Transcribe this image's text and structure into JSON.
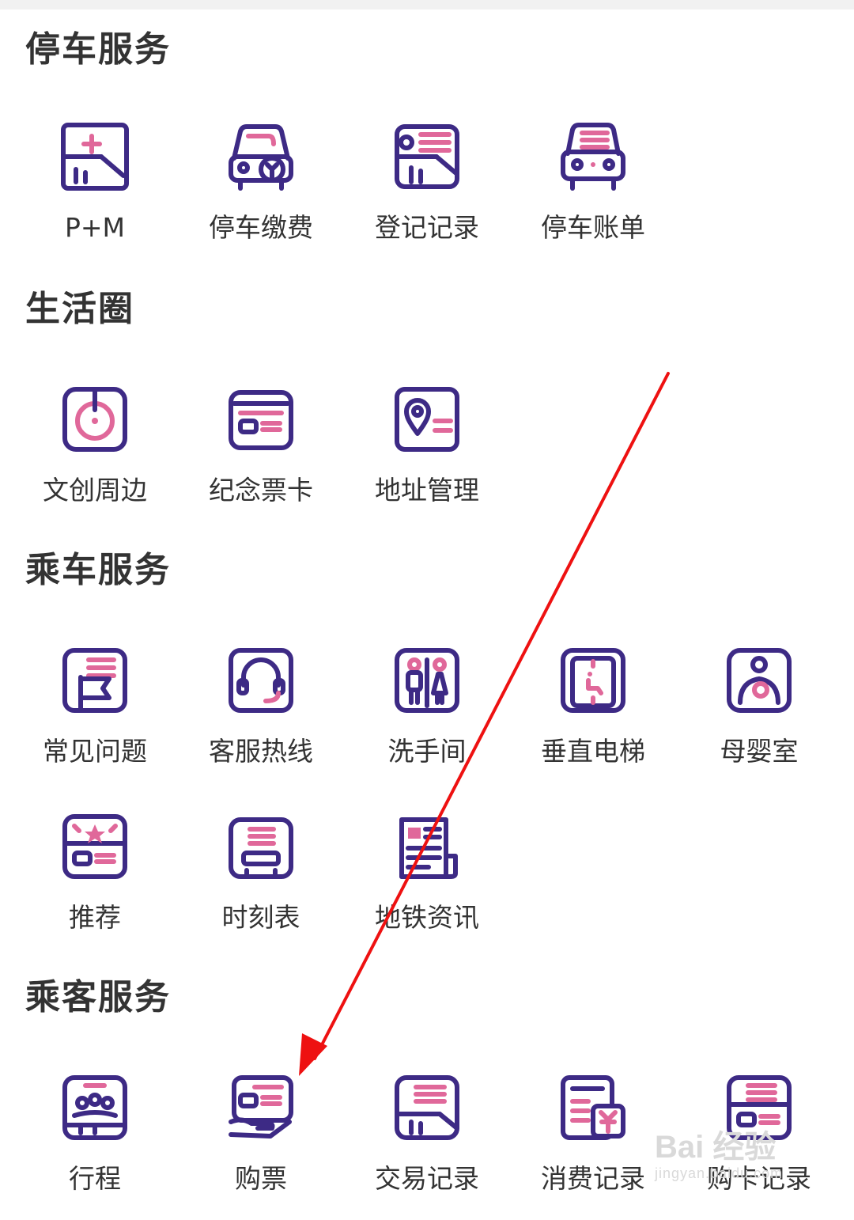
{
  "colors": {
    "icon_primary": "#3d2a85",
    "icon_accent": "#e0689a",
    "annotation_arrow": "#ee1111"
  },
  "sections": [
    {
      "title": "停车服务",
      "items": [
        {
          "label": "P+M",
          "icon": "p-plus-m-icon"
        },
        {
          "label": "停车缴费",
          "icon": "parking-payment-icon"
        },
        {
          "label": "登记记录",
          "icon": "registration-record-icon"
        },
        {
          "label": "停车账单",
          "icon": "parking-bill-icon"
        }
      ]
    },
    {
      "title": "生活圈",
      "items": [
        {
          "label": "文创周边",
          "icon": "cultural-products-icon"
        },
        {
          "label": "纪念票卡",
          "icon": "souvenir-card-icon"
        },
        {
          "label": "地址管理",
          "icon": "address-management-icon"
        }
      ]
    },
    {
      "title": "乘车服务",
      "items": [
        {
          "label": "常见问题",
          "icon": "faq-icon"
        },
        {
          "label": "客服热线",
          "icon": "customer-hotline-icon"
        },
        {
          "label": "洗手间",
          "icon": "restroom-icon"
        },
        {
          "label": "垂直电梯",
          "icon": "elevator-icon"
        },
        {
          "label": "母婴室",
          "icon": "nursing-room-icon"
        },
        {
          "label": "推荐",
          "icon": "recommend-icon"
        },
        {
          "label": "时刻表",
          "icon": "timetable-icon"
        },
        {
          "label": "地铁资讯",
          "icon": "metro-news-icon"
        }
      ]
    },
    {
      "title": "乘客服务",
      "items": [
        {
          "label": "行程",
          "icon": "trip-icon"
        },
        {
          "label": "购票",
          "icon": "buy-ticket-icon"
        },
        {
          "label": "交易记录",
          "icon": "transaction-record-icon"
        },
        {
          "label": "消费记录",
          "icon": "consumption-record-icon"
        },
        {
          "label": "购卡记录",
          "icon": "card-purchase-record-icon"
        }
      ]
    }
  ],
  "watermark": {
    "main": "Bai 经验",
    "sub": "jingyan.baidu.com"
  }
}
